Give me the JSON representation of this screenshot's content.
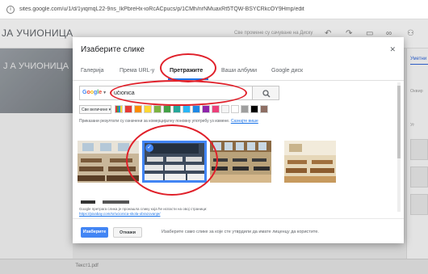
{
  "browser": {
    "url": "sites.google.com/u/1/d/1yiqmqL22-9ns_IkPbreHx-ioRcACpucs/p/1CMh/nrNMuaxRt5TQW-BSYCRkcOY9Hmp/edit"
  },
  "editor": {
    "site_title": "ЈА УЧИОНИЦА",
    "banner_title": "Ј А УЧИОНИЦА",
    "status": "Све промене су сачуване на Диску",
    "right_panel": {
      "tab": "Уметни",
      "items": [
        "Оквир",
        "Уг"
      ]
    },
    "bottom_file": "  Текст1.pdf"
  },
  "modal": {
    "title": "Изаберите слике",
    "close_icon": "close-icon",
    "tabs": [
      {
        "label": "Галерија",
        "active": false
      },
      {
        "label": "Према URL-у",
        "active": false
      },
      {
        "label": "Претражите",
        "active": true
      },
      {
        "label": "Ваши албуми",
        "active": false
      },
      {
        "label": "Google диск",
        "active": false
      }
    ],
    "search": {
      "engine": "Google",
      "value": "učionica"
    },
    "filters": {
      "size": "Све величине",
      "colors": [
        "#ffffff",
        "#e53935",
        "#fb8c00",
        "#fdd835",
        "#7cb342",
        "#43a047",
        "#26a69a",
        "#29b6f6",
        "#1e88e5",
        "#8e24aa",
        "#ec407a",
        "#f5f5f5",
        "#ffffff",
        "#9e9e9e",
        "#000000",
        "#8d6e63"
      ]
    },
    "notice": {
      "text": "Приказани резултати су означени за комерцијалну поновну употребу уз измене.",
      "link": "Сазнајте више"
    },
    "results": [
      {
        "name": "classroom-photo",
        "selected": false
      },
      {
        "name": "classroom-photo",
        "selected": true
      },
      {
        "name": "classroom-photo",
        "selected": false
      },
      {
        "name": "classroom-photo",
        "selected": false
      }
    ],
    "source": {
      "text": "Google претрага слика је пронашла слику која ће испасти на овој страници:",
      "link": "https://pixabay.com/sr/ucionica-skola-obrazovanje/"
    },
    "footer": {
      "select": "Изаберите",
      "cancel": "Откажи",
      "note": "Изаберите само слике за које сте утврдили да имате лиценцу да користите."
    }
  }
}
